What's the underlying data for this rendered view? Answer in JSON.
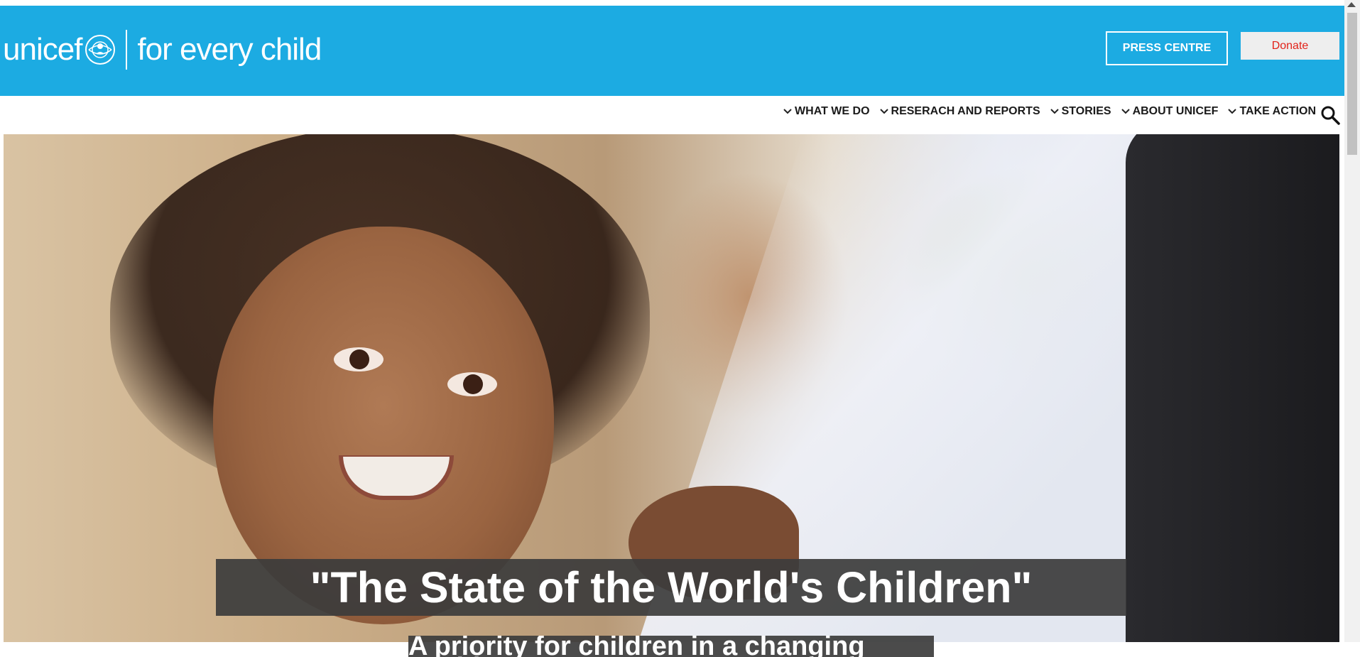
{
  "header": {
    "logo_text": "unicef",
    "tagline": "for every child",
    "press_label": "PRESS CENTRE",
    "donate_label": "Donate",
    "bg_color": "#1cabe2",
    "donate_text_color": "#e2231a"
  },
  "nav": {
    "items": [
      {
        "label": "WHAT WE DO",
        "icon": "chevron-down-icon"
      },
      {
        "label": "RESERACH AND REPORTS",
        "icon": "chevron-down-icon"
      },
      {
        "label": "STORIES",
        "icon": "chevron-down-icon"
      },
      {
        "label": "ABOUT UNICEF",
        "icon": "chevron-down-icon"
      },
      {
        "label": "TAKE ACTION",
        "icon": "chevron-down-icon"
      }
    ],
    "search_icon": "search-icon"
  },
  "hero": {
    "title": "\"The State of the World's Children\"",
    "subtitle": "A priority for children in a changing world"
  }
}
